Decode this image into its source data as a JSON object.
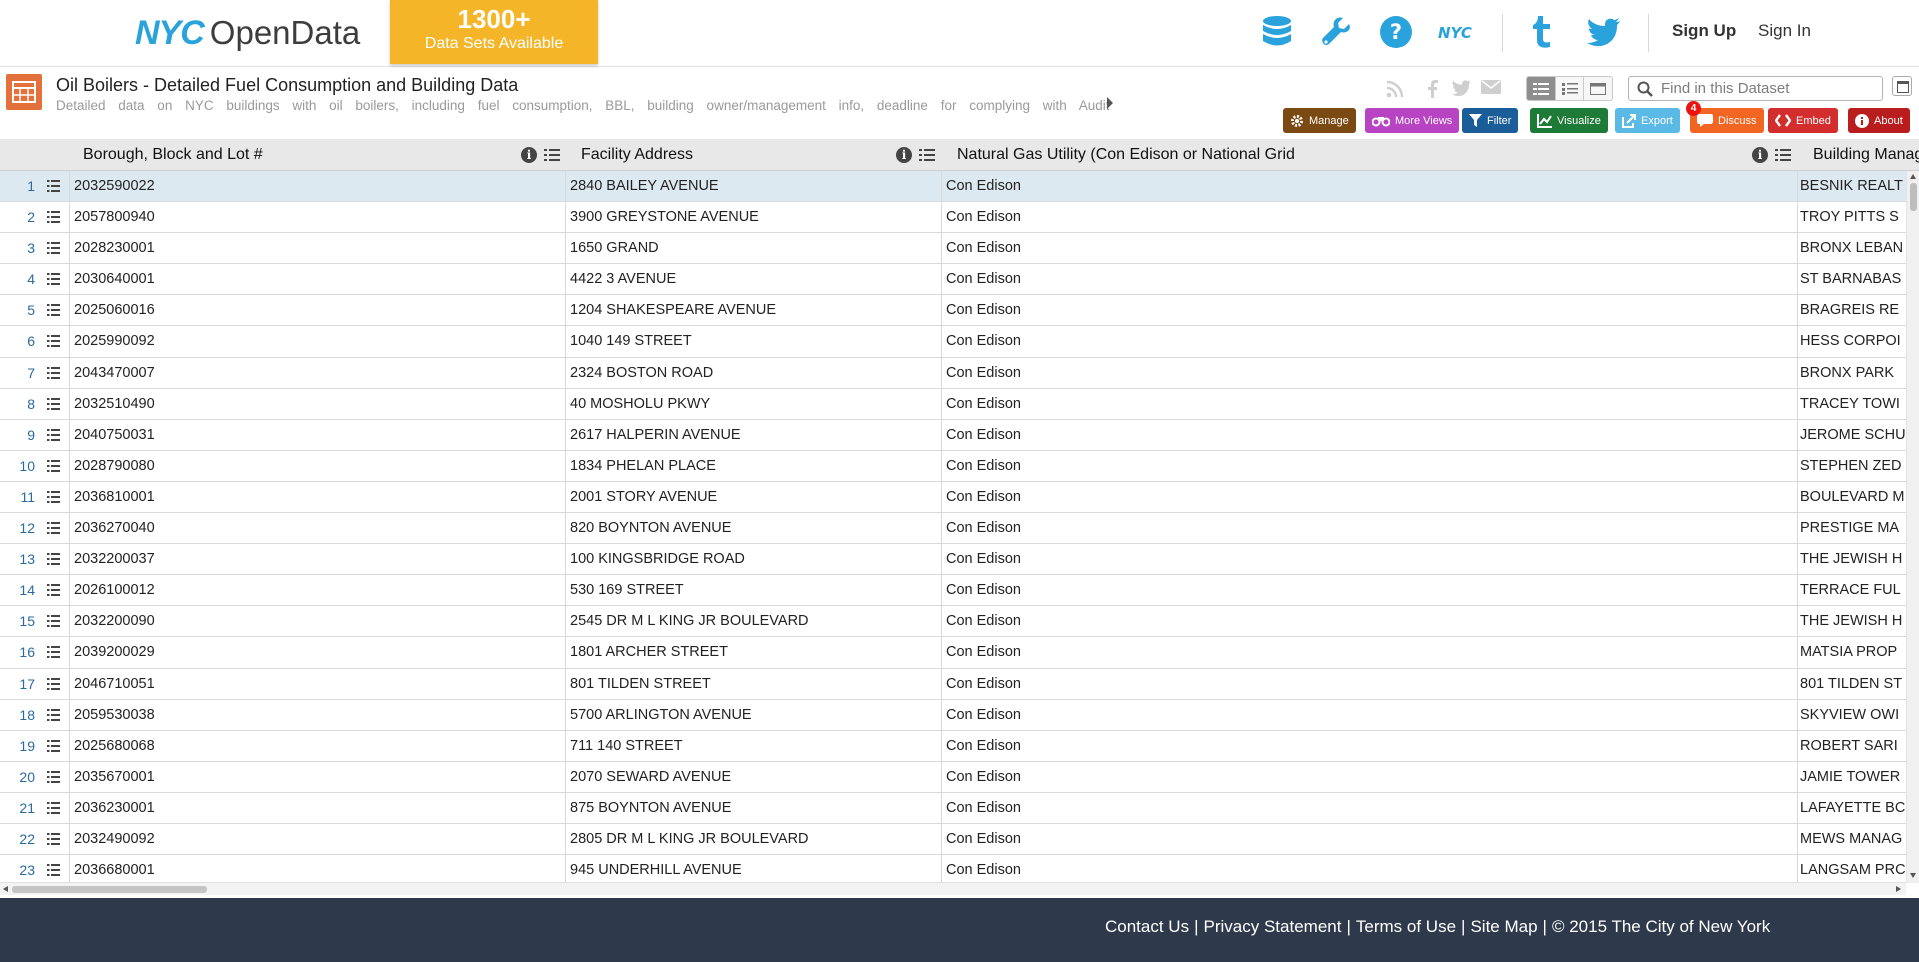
{
  "header": {
    "logo_nyc": "NYC",
    "logo_opendata": "OpenData",
    "banner_count": "1300+",
    "banner_label": "Data Sets Available",
    "icons": [
      "database-icon",
      "wrench-icon",
      "help-icon",
      "nyc-logo-icon",
      "tumblr-icon",
      "twitter-icon"
    ],
    "sign_up": "Sign Up",
    "sign_in": "Sign In",
    "accent": "#2aa3dc",
    "banner_color": "#f4b528"
  },
  "dataset": {
    "title": "Oil Boilers - Detailed Fuel Consumption and Building Data",
    "description": "Detailed data on NYC buildings with oil boilers, including fuel consumption, BBL, building owner/management info, deadline for complying with Audit and",
    "search_placeholder": "Find in this Dataset",
    "share_icons": [
      "rss-icon",
      "facebook-icon",
      "twitter-icon",
      "email-icon"
    ]
  },
  "toolbar": {
    "manage": "Manage",
    "more_views": "More Views",
    "filter": "Filter",
    "visualize": "Visualize",
    "export": "Export",
    "discuss": "Discuss",
    "discuss_badge": "4",
    "embed": "Embed",
    "about": "About",
    "colors": {
      "manage": "#7b4a13",
      "more_views": "#b844c4",
      "filter": "#1a5d98",
      "visualize": "#1e7a37",
      "export": "#5ab9e5",
      "discuss": "#f26522",
      "embed": "#d42d2d",
      "about": "#b91d1d"
    }
  },
  "columns": [
    "Borough, Block and Lot #",
    "Facility Address",
    "Natural Gas Utility (Con Edison or National Grid",
    "Building Manag"
  ],
  "rows": [
    {
      "n": "1",
      "bbl": "2032590022",
      "addr": "2840 BAILEY AVENUE",
      "gas": "Con Edison",
      "mgr": "BESNIK REALT"
    },
    {
      "n": "2",
      "bbl": "2057800940",
      "addr": "3900 GREYSTONE AVENUE",
      "gas": "Con Edison",
      "mgr": "TROY PITTS S"
    },
    {
      "n": "3",
      "bbl": "2028230001",
      "addr": "1650 GRAND",
      "gas": "Con Edison",
      "mgr": "BRONX LEBAN"
    },
    {
      "n": "4",
      "bbl": "2030640001",
      "addr": "4422 3 AVENUE",
      "gas": "Con Edison",
      "mgr": "ST BARNABAS"
    },
    {
      "n": "5",
      "bbl": "2025060016",
      "addr": "1204 SHAKESPEARE AVENUE",
      "gas": "Con Edison",
      "mgr": "BRAGREIS RE"
    },
    {
      "n": "6",
      "bbl": "2025990092",
      "addr": "1040 149 STREET",
      "gas": "Con Edison",
      "mgr": "HESS CORPOI"
    },
    {
      "n": "7",
      "bbl": "2043470007",
      "addr": "2324 BOSTON ROAD",
      "gas": "Con Edison",
      "mgr": "BRONX PARK"
    },
    {
      "n": "8",
      "bbl": "2032510490",
      "addr": "40 MOSHOLU PKWY",
      "gas": "Con Edison",
      "mgr": "TRACEY TOWI"
    },
    {
      "n": "9",
      "bbl": "2040750031",
      "addr": "2617 HALPERIN AVENUE",
      "gas": "Con Edison",
      "mgr": "JEROME SCHU"
    },
    {
      "n": "10",
      "bbl": "2028790080",
      "addr": "1834 PHELAN PLACE",
      "gas": "Con Edison",
      "mgr": "STEPHEN ZED"
    },
    {
      "n": "11",
      "bbl": "2036810001",
      "addr": "2001 STORY AVENUE",
      "gas": "Con Edison",
      "mgr": "BOULEVARD M"
    },
    {
      "n": "12",
      "bbl": "2036270040",
      "addr": "820 BOYNTON AVENUE",
      "gas": "Con Edison",
      "mgr": "PRESTIGE MA"
    },
    {
      "n": "13",
      "bbl": "2032200037",
      "addr": "100 KINGSBRIDGE ROAD",
      "gas": "Con Edison",
      "mgr": "THE JEWISH H"
    },
    {
      "n": "14",
      "bbl": "2026100012",
      "addr": "530 169 STREET",
      "gas": "Con Edison",
      "mgr": "TERRACE FUL"
    },
    {
      "n": "15",
      "bbl": "2032200090",
      "addr": "2545 DR M L KING JR BOULEVARD",
      "gas": "Con Edison",
      "mgr": "THE JEWISH H"
    },
    {
      "n": "16",
      "bbl": "2039200029",
      "addr": "1801 ARCHER STREET",
      "gas": "Con Edison",
      "mgr": "MATSIA PROP"
    },
    {
      "n": "17",
      "bbl": "2046710051",
      "addr": "801 TILDEN STREET",
      "gas": "Con Edison",
      "mgr": "801 TILDEN ST"
    },
    {
      "n": "18",
      "bbl": "2059530038",
      "addr": "5700 ARLINGTON AVENUE",
      "gas": "Con Edison",
      "mgr": "SKYVIEW OWI"
    },
    {
      "n": "19",
      "bbl": "2025680068",
      "addr": "711 140 STREET",
      "gas": "Con Edison",
      "mgr": "ROBERT SARI"
    },
    {
      "n": "20",
      "bbl": "2035670001",
      "addr": "2070 SEWARD AVENUE",
      "gas": "Con Edison",
      "mgr": "JAMIE TOWER"
    },
    {
      "n": "21",
      "bbl": "2036230001",
      "addr": "875 BOYNTON AVENUE",
      "gas": "Con Edison",
      "mgr": "LAFAYETTE BC"
    },
    {
      "n": "22",
      "bbl": "2032490092",
      "addr": "2805 DR M L KING JR BOULEVARD",
      "gas": "Con Edison",
      "mgr": "MEWS MANAG"
    },
    {
      "n": "23",
      "bbl": "2036680001",
      "addr": "945 UNDERHILL AVENUE",
      "gas": "Con Edison",
      "mgr": "LANGSAM PRC"
    }
  ],
  "footer": {
    "contact": "Contact Us",
    "privacy": "Privacy Statement",
    "terms": "Terms of Use",
    "sitemap": "Site Map",
    "copyright": "© 2015 The City of New York"
  }
}
